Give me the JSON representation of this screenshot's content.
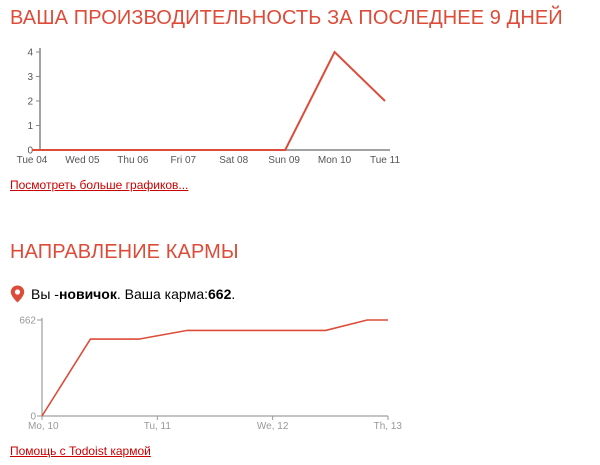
{
  "productivity": {
    "title": "ВАША ПРОИЗВОДИТЕЛЬНОСТЬ ЗА ПОСЛЕДНЕЕ 9 ДНЕЙ",
    "more_link": "Посмотреть больше графиков..."
  },
  "karma": {
    "title": "НАПРАВЛЕНИЕ КАРМЫ",
    "status_prefix": "Вы - ",
    "level": "новичок",
    "karma_label": ". Ваша карма: ",
    "karma_value": "662",
    "status_suffix": ".",
    "help_link": "Помощь с Todoist кармой"
  },
  "colors": {
    "accent": "#dd4b39",
    "line": "#dd4b39",
    "link": "#cc0000"
  },
  "icons": {
    "karma_marker": "map-pin-icon"
  },
  "chart_data": [
    {
      "type": "line",
      "title": "",
      "xlabel": "",
      "ylabel": "",
      "categories": [
        "Tue 04",
        "Wed 05",
        "Thu 06",
        "Fri 07",
        "Sat 08",
        "Sun 09",
        "Mon 10",
        "Tue 11"
      ],
      "x": [
        "Tue 04",
        "Wed 05",
        "Thu 06",
        "Fri 07",
        "Sat 08",
        "Sun 09",
        "Sun 09+",
        "Mon 10",
        "Tue 11"
      ],
      "values": [
        0,
        0,
        0,
        0,
        0,
        0,
        0,
        4,
        2
      ],
      "ylim": [
        0,
        4
      ],
      "yticks": [
        0,
        1,
        2,
        3,
        4
      ],
      "grid": false,
      "legend": "none"
    },
    {
      "type": "line",
      "title": "",
      "xlabel": "",
      "ylabel": "",
      "xticks": [
        "Mo, 10",
        "Tu, 11",
        "We, 12",
        "Th, 13"
      ],
      "x": [
        0,
        0.14,
        0.28,
        0.42,
        0.58,
        0.82,
        0.94,
        1.0
      ],
      "values": [
        0,
        530,
        530,
        590,
        590,
        590,
        662,
        662
      ],
      "ylim": [
        0,
        662
      ],
      "yticks": [
        0,
        662
      ],
      "grid": false,
      "legend": "none"
    }
  ]
}
